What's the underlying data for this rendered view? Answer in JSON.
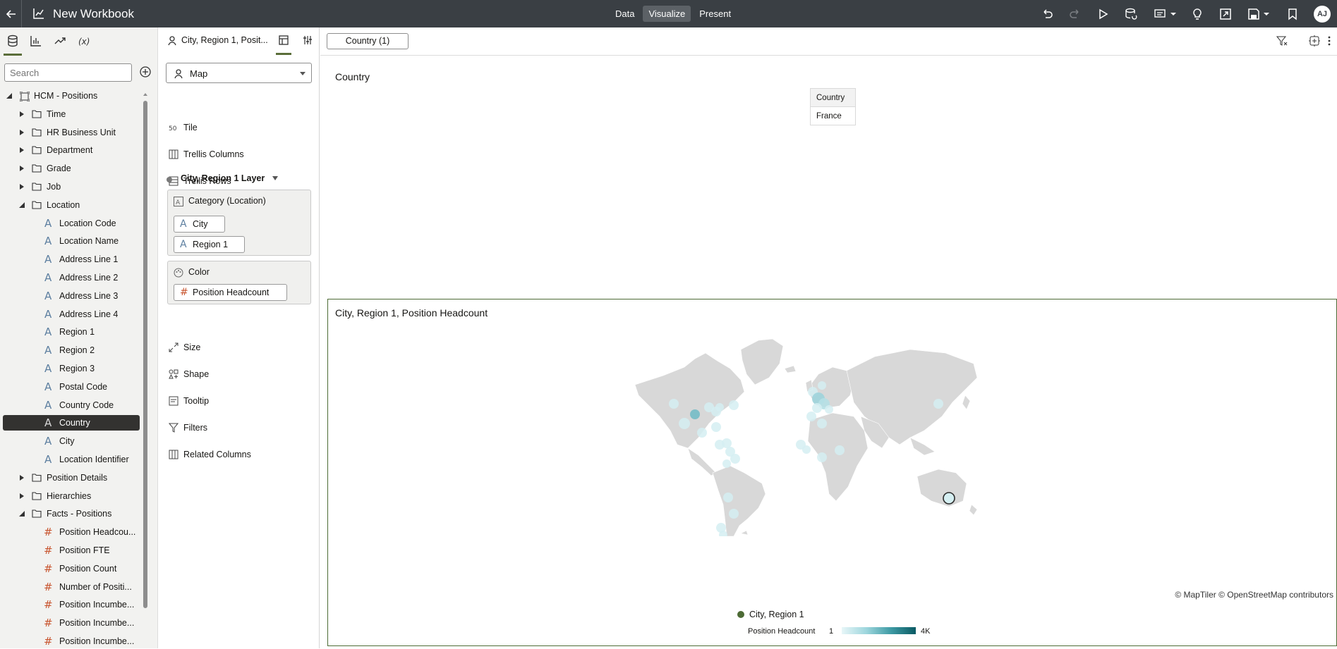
{
  "app": {
    "title": "New Workbook",
    "tabs": [
      {
        "label": "Data",
        "active": false
      },
      {
        "label": "Visualize",
        "active": true
      },
      {
        "label": "Present",
        "active": false
      }
    ],
    "user_initials": "AJ",
    "toolbar_icons": [
      "undo-icon",
      "redo-icon",
      "play-icon",
      "refresh-data-icon",
      "narrate-icon",
      "insights-lightbulb-icon",
      "export-icon",
      "save-icon",
      "bookmark-icon"
    ]
  },
  "data_panel": {
    "tab_icons": [
      "data-icon",
      "visualizations-icon",
      "analytics-icon",
      "calculations-icon"
    ],
    "search_placeholder": "Search",
    "tree": {
      "root": "HCM - Positions",
      "folders_top": [
        "Time",
        "HR Business Unit",
        "Department",
        "Grade",
        "Job"
      ],
      "location": {
        "label": "Location",
        "items": [
          "Location Code",
          "Location Name",
          "Address Line 1",
          "Address Line 2",
          "Address Line 3",
          "Address Line 4",
          "Region 1",
          "Region 2",
          "Region 3",
          "Postal Code",
          "Country Code",
          "Country",
          "City",
          "Location Identifier"
        ],
        "selected": "Country"
      },
      "folders_mid": [
        "Position Details",
        "Hierarchies"
      ],
      "facts": {
        "label": "Facts - Positions",
        "items": [
          "Position Headcou...",
          "Position FTE",
          "Position Count",
          "Number of Positi...",
          "Position Incumbe...",
          "Position Incumbe...",
          "Position Incumbe..."
        ]
      }
    }
  },
  "grammar_panel": {
    "viz_title": "City, Region 1, Posit...",
    "viz_type": "Map",
    "items_top": [
      "Tile",
      "Trellis Columns",
      "Trellis Rows"
    ],
    "layer_label": "City, Region 1 Layer",
    "category": {
      "label": "Category (Location)",
      "pills": [
        "City",
        "Region 1"
      ]
    },
    "color": {
      "label": "Color",
      "pills": [
        "Position Headcount"
      ]
    },
    "items_bottom": [
      "Size",
      "Shape",
      "Tooltip",
      "Filters",
      "Related Columns"
    ]
  },
  "canvas": {
    "filter_chip": "Country (1)",
    "viz1": {
      "title": "Country",
      "table": {
        "header": "Country",
        "rows": [
          "France"
        ]
      }
    },
    "viz2": {
      "title": "City, Region 1, Position Headcount",
      "credit": "© MapTiler © OpenStreetMap contributors",
      "legend": {
        "series": "City, Region 1",
        "measure": "Position Headcount",
        "min": "1",
        "max": "4K"
      },
      "colors": {
        "low": "#e8f6f8",
        "high": "#0a5a63",
        "series_dot": "#4d6b35"
      }
    }
  }
}
